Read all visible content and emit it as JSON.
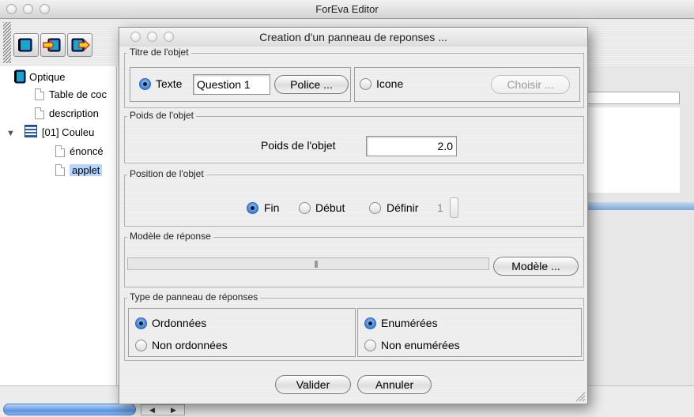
{
  "main_window": {
    "title": "ForEva Editor"
  },
  "toolbar": {
    "buttons": [
      {
        "icon": "book-icon"
      },
      {
        "icon": "add-book-icon"
      },
      {
        "icon": "export-book-icon"
      }
    ]
  },
  "tree": {
    "items": [
      {
        "label": "Optique",
        "icon": "book-icon"
      },
      {
        "label": "Table de coc",
        "icon": "document-icon"
      },
      {
        "label": "description",
        "icon": "document-icon"
      },
      {
        "label": "[01] Couleu",
        "icon": "list-icon",
        "expanded": true
      },
      {
        "label": "énoncé",
        "icon": "document-icon"
      },
      {
        "label": "applet",
        "icon": "document-icon",
        "selected": true
      }
    ]
  },
  "dialog": {
    "title": "Creation d'un panneau de reponses ...",
    "titre": {
      "legend": "Titre de l'objet",
      "texte_label": "Texte",
      "texte_selected": true,
      "texte_value": "Question 1",
      "police_button": "Police ...",
      "icone_label": "Icone",
      "icone_selected": false,
      "choisir_button": "Choisir ..."
    },
    "poids": {
      "legend": "Poids de l'objet",
      "label": "Poids de l'objet",
      "value": "2.0"
    },
    "position": {
      "legend": "Position de l'objet",
      "options": [
        {
          "label": "Fin",
          "selected": true
        },
        {
          "label": "Début",
          "selected": false
        },
        {
          "label": "Définir",
          "selected": false
        }
      ],
      "stepper_value": "1"
    },
    "modele": {
      "legend": "Modèle de réponse",
      "button": "Modèle ..."
    },
    "type": {
      "legend": "Type de panneau de réponses",
      "ordre_options": [
        {
          "label": "Ordonnées",
          "selected": true
        },
        {
          "label": "Non ordonnées",
          "selected": false
        }
      ],
      "enum_options": [
        {
          "label": "Enumérées",
          "selected": true
        },
        {
          "label": "Non enumérées",
          "selected": false
        }
      ]
    },
    "valider_button": "Valider",
    "annuler_button": "Annuler"
  }
}
